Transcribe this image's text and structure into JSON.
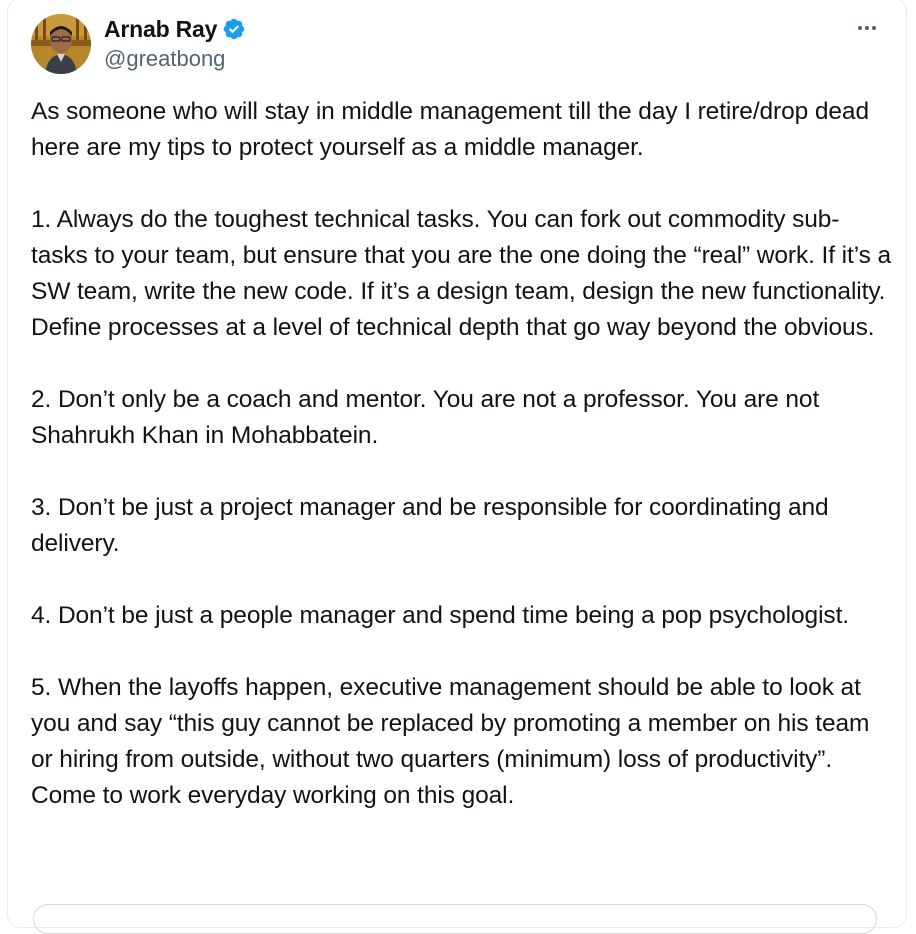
{
  "author": {
    "display_name": "Arnab Ray",
    "handle": "@greatbong",
    "verified": true,
    "verified_color": "#1d9bf0"
  },
  "icons": {
    "avatar": "profile-photo",
    "verified": "verified-badge-icon",
    "more": "more-options-icon"
  },
  "tweet": {
    "paragraphs": [
      "As someone who will stay in middle management till the day I retire/drop dead here are my tips to protect yourself as a middle manager.",
      "1. Always do the toughest technical tasks. You can fork out commodity sub-tasks to your team, but ensure that you are the one doing the “real” work. If it’s a SW team, write the new code. If it’s a design team, design the new functionality. Define processes at a level of technical depth that go way beyond the obvious.",
      "2. Don’t only be a coach and mentor. You are not a professor. You are not Shahrukh Khan in Mohabbatein.",
      "3. Don’t be just a project manager and be responsible for coordinating and delivery.",
      "4. Don’t be just a people manager and spend time being a pop psychologist.",
      "5. When the layoffs happen, executive management should be able to look at you and say “this guy cannot be replaced by promoting a member on his team or hiring from outside, without two quarters (minimum) loss of productivity”. Come to work everyday working on this goal."
    ]
  },
  "colors": {
    "text": "#0f1419",
    "secondary_text": "#536471",
    "border": "#e6ecf0"
  }
}
